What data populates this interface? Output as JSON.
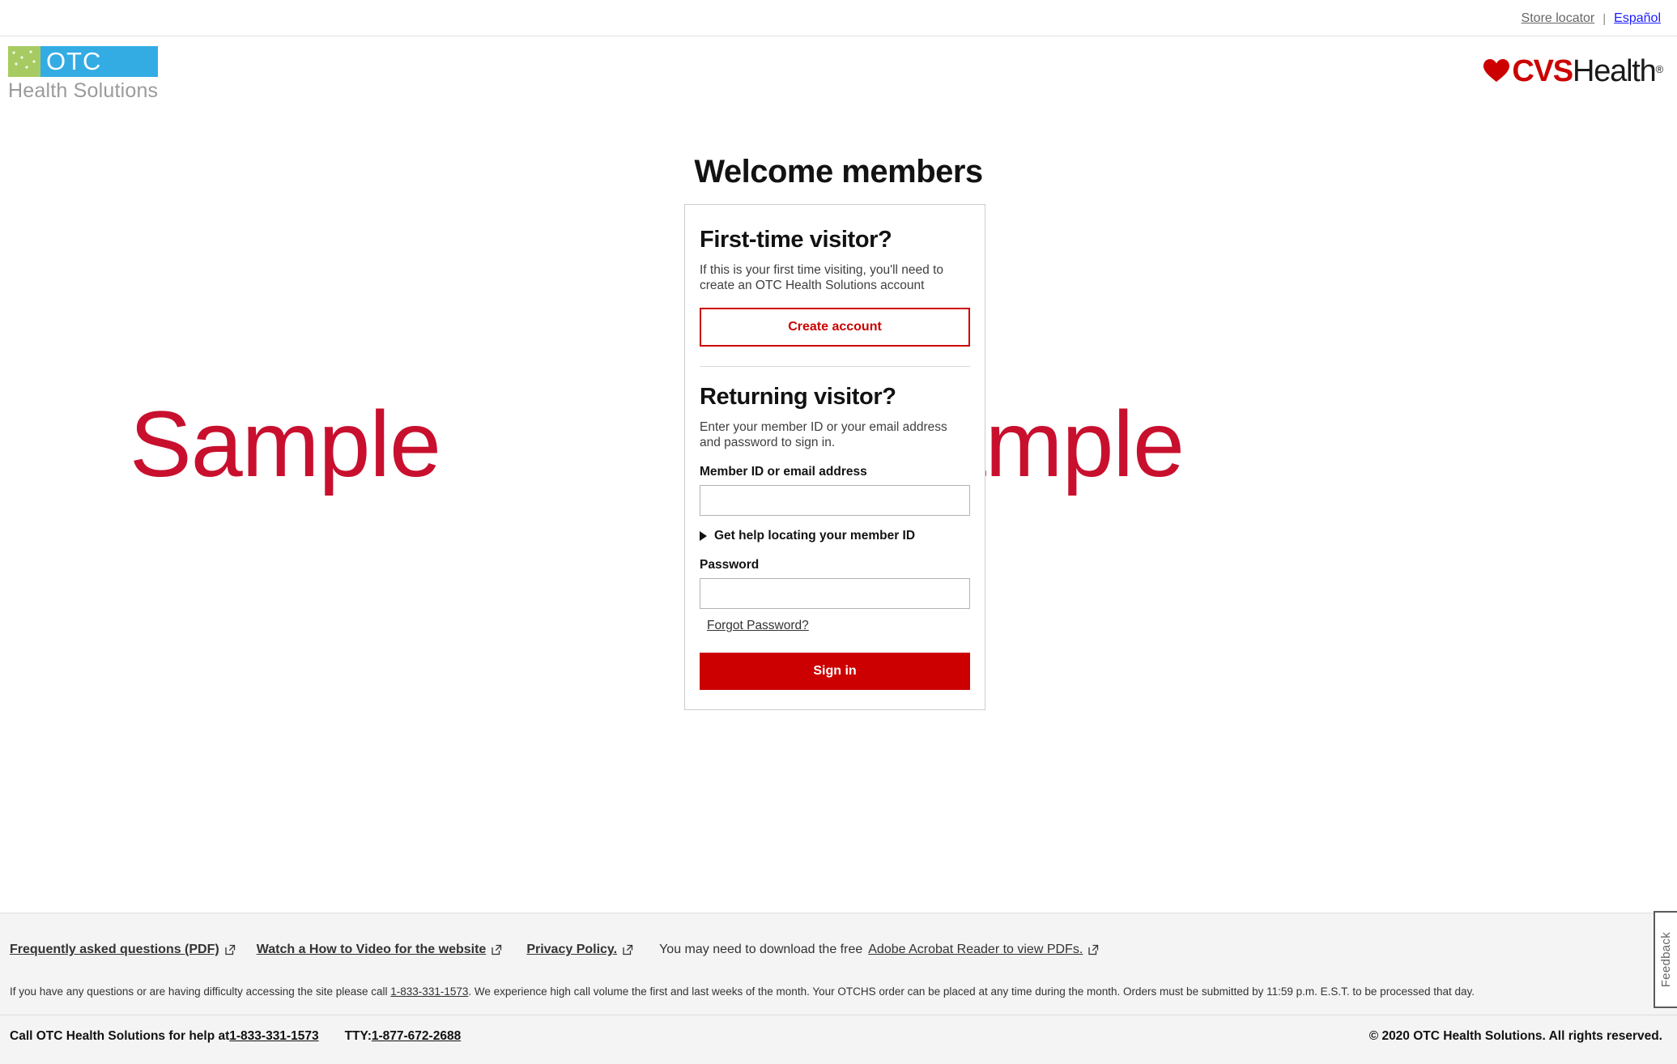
{
  "topbar": {
    "store_locator": "Store locator",
    "separator": "|",
    "espanol": "Español"
  },
  "header": {
    "otc_logo": {
      "mark_text": "OTC",
      "subtitle": "Health Solutions",
      "green_hex": "#a7cb62",
      "blue_hex": "#33ace3",
      "subtitle_hex": "#9b9b9b"
    },
    "cvs_logo": {
      "brand": "CVS",
      "brand_suffix": "Health",
      "registered": "®",
      "red_hex": "#cc0000"
    }
  },
  "watermarks": {
    "left": "Sample",
    "right": "Sample",
    "color_hex": "#c8102e"
  },
  "main": {
    "page_title": "Welcome members",
    "card": {
      "first_time": {
        "heading": "First-time visitor?",
        "description": "If this is your first time visiting, you'll need to create an OTC Health Solutions account",
        "create_account_label": "Create account"
      },
      "returning": {
        "heading": "Returning visitor?",
        "description": "Enter your member ID or your email address and password to sign in.",
        "member_id_label": "Member ID or email address",
        "member_id_value": "",
        "member_id_placeholder": "",
        "help_locating_label": "Get help locating your member ID",
        "password_label": "Password",
        "password_value": "",
        "password_placeholder": "",
        "forgot_password_label": "Forgot Password?",
        "sign_in_label": "Sign in"
      }
    },
    "accent_red_hex": "#cc0000"
  },
  "footer": {
    "links": [
      {
        "label": "Frequently asked questions (PDF)",
        "icon": "external-link-icon"
      },
      {
        "label": "Watch a How to Video for the website",
        "icon": "external-link-icon"
      },
      {
        "label": "Privacy Policy.",
        "icon": "external-link-icon"
      }
    ],
    "acrobat_prefix": "You may need to download the free",
    "acrobat_link": "Adobe Acrobat Reader to view PDFs.",
    "acrobat_icon": "external-link-icon",
    "note_part1": "If you have any questions or are having difficulty accessing the site please call ",
    "note_phone": "1-833-331-1573",
    "note_part2": ". We experience high call volume the first and last weeks of the month. Your OTCHS order can be placed at any time during the month. Orders must be submitted by 11:59 p.m. E.S.T. to be processed that day.",
    "bottom": {
      "help_prefix": "Call OTC Health Solutions for help at ",
      "help_phone": "1-833-331-1573",
      "tty_label": "TTY: ",
      "tty_phone": "1-877-672-2688",
      "copyright": "© 2020 OTC Health Solutions. All rights reserved."
    }
  },
  "feedback": {
    "label": "Feedback"
  }
}
